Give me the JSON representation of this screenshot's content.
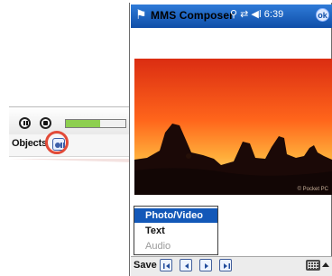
{
  "device": {
    "title": "MMS Composer",
    "status_time": "6:39",
    "ok_label": "ok"
  },
  "zoomed_detail": {
    "objects_label": "Objects",
    "progress_fraction": 0.58,
    "highlight_color": "#e24a38"
  },
  "menu": {
    "items": [
      {
        "label": "Photo/Video",
        "state": "active"
      },
      {
        "label": "Text",
        "state": "normal"
      },
      {
        "label": "Audio",
        "state": "disabled"
      }
    ]
  },
  "bottom_bar": {
    "save_label": "Save",
    "icons": [
      "first-icon",
      "previous-icon",
      "next-icon",
      "last-icon",
      "keyboard-icon",
      "input-arrow-icon"
    ]
  },
  "colors": {
    "accent": "#1358b8",
    "title_bar": "#0f4ea8",
    "progress": "#8dcf4f"
  }
}
